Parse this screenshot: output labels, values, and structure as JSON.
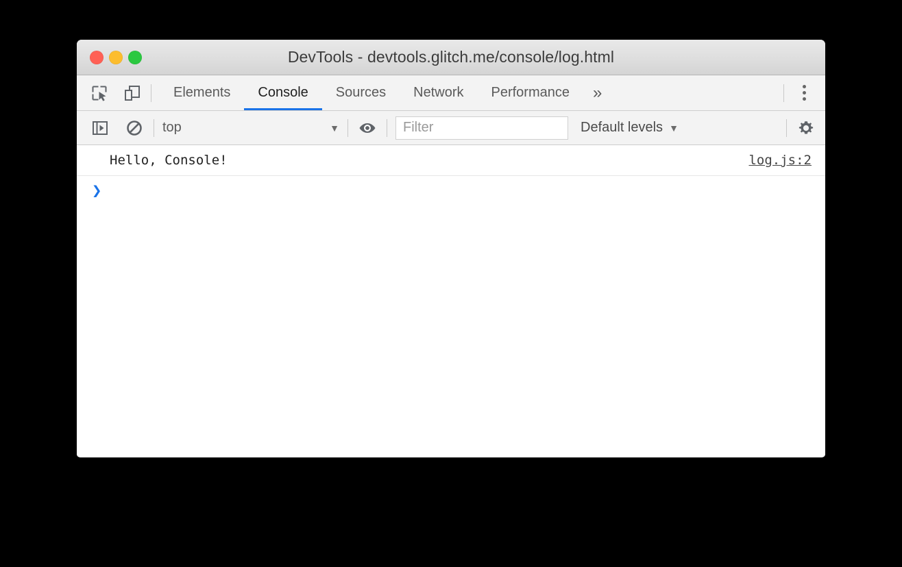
{
  "window": {
    "title": "DevTools - devtools.glitch.me/console/log.html",
    "traffic_lights": [
      {
        "name": "close",
        "color": "#ff6055"
      },
      {
        "name": "minimize",
        "color": "#fcbd2e"
      },
      {
        "name": "zoom",
        "color": "#2bc840"
      }
    ]
  },
  "tabbar": {
    "icons": [
      {
        "name": "inspect-element-icon",
        "label": "Inspect element"
      },
      {
        "name": "device-toolbar-icon",
        "label": "Toggle device toolbar"
      }
    ],
    "tabs": [
      {
        "label": "Elements",
        "active": false
      },
      {
        "label": "Console",
        "active": true
      },
      {
        "label": "Sources",
        "active": false
      },
      {
        "label": "Network",
        "active": false
      },
      {
        "label": "Performance",
        "active": false
      }
    ],
    "more_label": "»",
    "menu_label": "Customize and control DevTools"
  },
  "console_toolbar": {
    "sidebar_toggle": "Show console sidebar",
    "clear_console": "Clear console",
    "context": {
      "value": "top",
      "caret": "▼"
    },
    "eye_icon": "Create live expression",
    "filter": {
      "value": "",
      "placeholder": "Filter"
    },
    "levels": {
      "label": "Default levels",
      "caret": "▼"
    },
    "settings": "Console settings"
  },
  "console": {
    "messages": [
      {
        "text": "Hello, Console!",
        "source": "log.js:2"
      }
    ],
    "prompt": {
      "caret": "❯",
      "value": ""
    }
  },
  "colors": {
    "accent": "#1a73e8",
    "titlebar_top": "#e9e9e9",
    "titlebar_bottom": "#d4d4d4",
    "toolbar_bg": "#f3f3f3",
    "body_bg": "#ffffff",
    "desktop_bg": "#000000"
  }
}
